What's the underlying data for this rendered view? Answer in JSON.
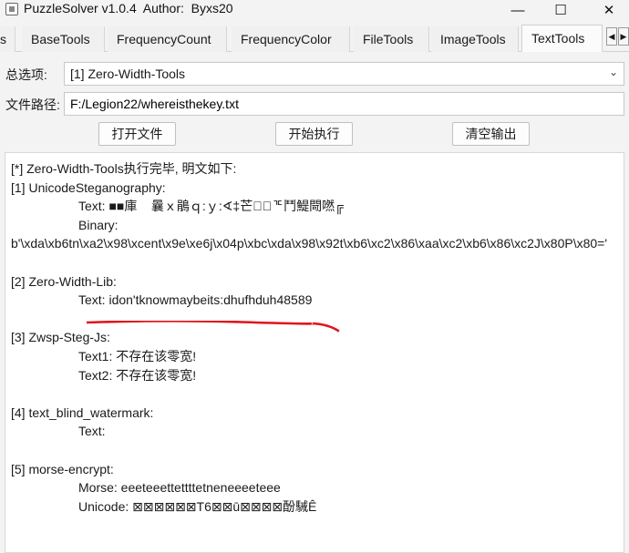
{
  "window": {
    "title": "PuzzleSolver v1.0.4  Author:  Byxs20",
    "minimize": "—",
    "maximize": "☐",
    "close": "✕"
  },
  "tabs": [
    {
      "label": "s"
    },
    {
      "label": "BaseTools"
    },
    {
      "label": "FrequencyCount"
    },
    {
      "label": "FrequencyColor"
    },
    {
      "label": "FileTools"
    },
    {
      "label": "ImageTools"
    },
    {
      "label": "TextTools"
    }
  ],
  "tab_scroll": {
    "left": "◀",
    "right": "▶"
  },
  "options": {
    "label": "总选项:",
    "value": "[1] Zero-Width-Tools",
    "chevron": "⌄"
  },
  "file_path": {
    "label": "文件路径:",
    "value": "F:/Legion22/whereisthekey.txt"
  },
  "buttons": {
    "open_file": "打开文件",
    "run": "开始执行",
    "clear": "清空输出"
  },
  "output": {
    "header": "[*] Zero-Width-Tools执行完毕, 明文如下:",
    "s1_title": "[1] UnicodeSteganography:",
    "s1_text": "Text: ■■庫    曩ｘ鵑ｑ:ｙ:∢‡芒髟᪹ᅚ鬥鯷閜嘫╔",
    "s1_binary_label": "Binary:",
    "s1_binary_value": "b'\\xda\\xb6tn\\xa2\\x98\\xcent\\x9e\\xe6j\\x04p\\xbc\\xda\\x98\\x92t\\xb6\\xc2\\x86\\xaa\\xc2\\xb6\\x86\\xc2J\\x80P\\x80='",
    "s2_title": "[2] Zero-Width-Lib:",
    "s2_text": "Text: idon'tknowmaybeits:dhufhduh48589",
    "s3_title": "[3] Zwsp-Steg-Js:",
    "s3_text1": "Text1: 不存在该零宽!",
    "s3_text2": "Text2: 不存在该零宽!",
    "s4_title": "[4] text_blind_watermark:",
    "s4_text": "Text:",
    "s5_title": "[5] morse-encrypt:",
    "s5_morse": "Morse: eeeteeettettttetneneeeeteee",
    "s5_unicode": "Unicode: ⊠⊠⊠⊠⊠⊠T6⊠⊠ū⊠⊠⊠⊠酚駴Ê"
  },
  "annotation_color": "#e0141c"
}
